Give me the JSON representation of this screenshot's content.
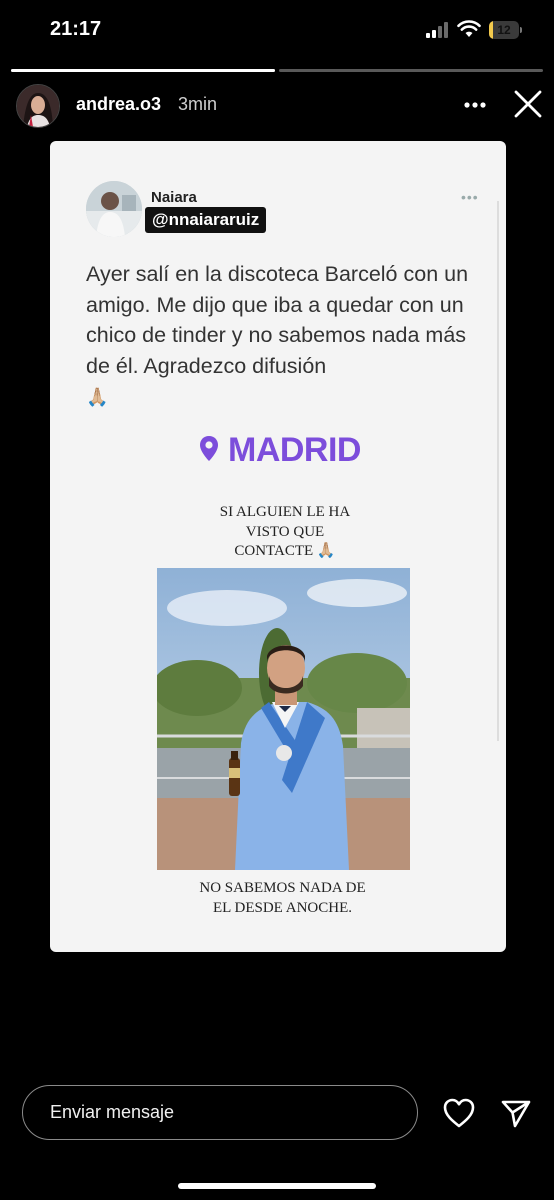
{
  "status_bar": {
    "time": "21:17",
    "battery_level": "12",
    "battery_fraction": 0.12,
    "battery_color": "#f2c94c"
  },
  "story": {
    "progress": [
      1.0,
      0.0
    ],
    "username": "andrea.o3",
    "time_ago": "3min"
  },
  "tweet": {
    "name": "Naiara",
    "handle": "@nnaiararuiz",
    "text": "Ayer salí en la discoteca Barceló con un amigo. Me dijo que iba a quedar con un chico de tinder y no sabemos nada más de él. Agradezco difusión",
    "emoji": "🙏🏼"
  },
  "poster": {
    "location": "MADRID",
    "location_color": "#7c4ddb",
    "top_line_1": "SI ALGUIEN LE HA",
    "top_line_2": "VISTO QUE",
    "top_line_3": "CONTACTE 🙏🏼",
    "bottom_line_1": "NO SABEMOS NADA DE",
    "bottom_line_2": "EL DESDE ANOCHE."
  },
  "reply": {
    "placeholder": "Enviar mensaje"
  },
  "icons": {
    "more": "more-horizontal-icon",
    "close": "close-icon",
    "like": "heart-icon",
    "send": "send-icon"
  }
}
